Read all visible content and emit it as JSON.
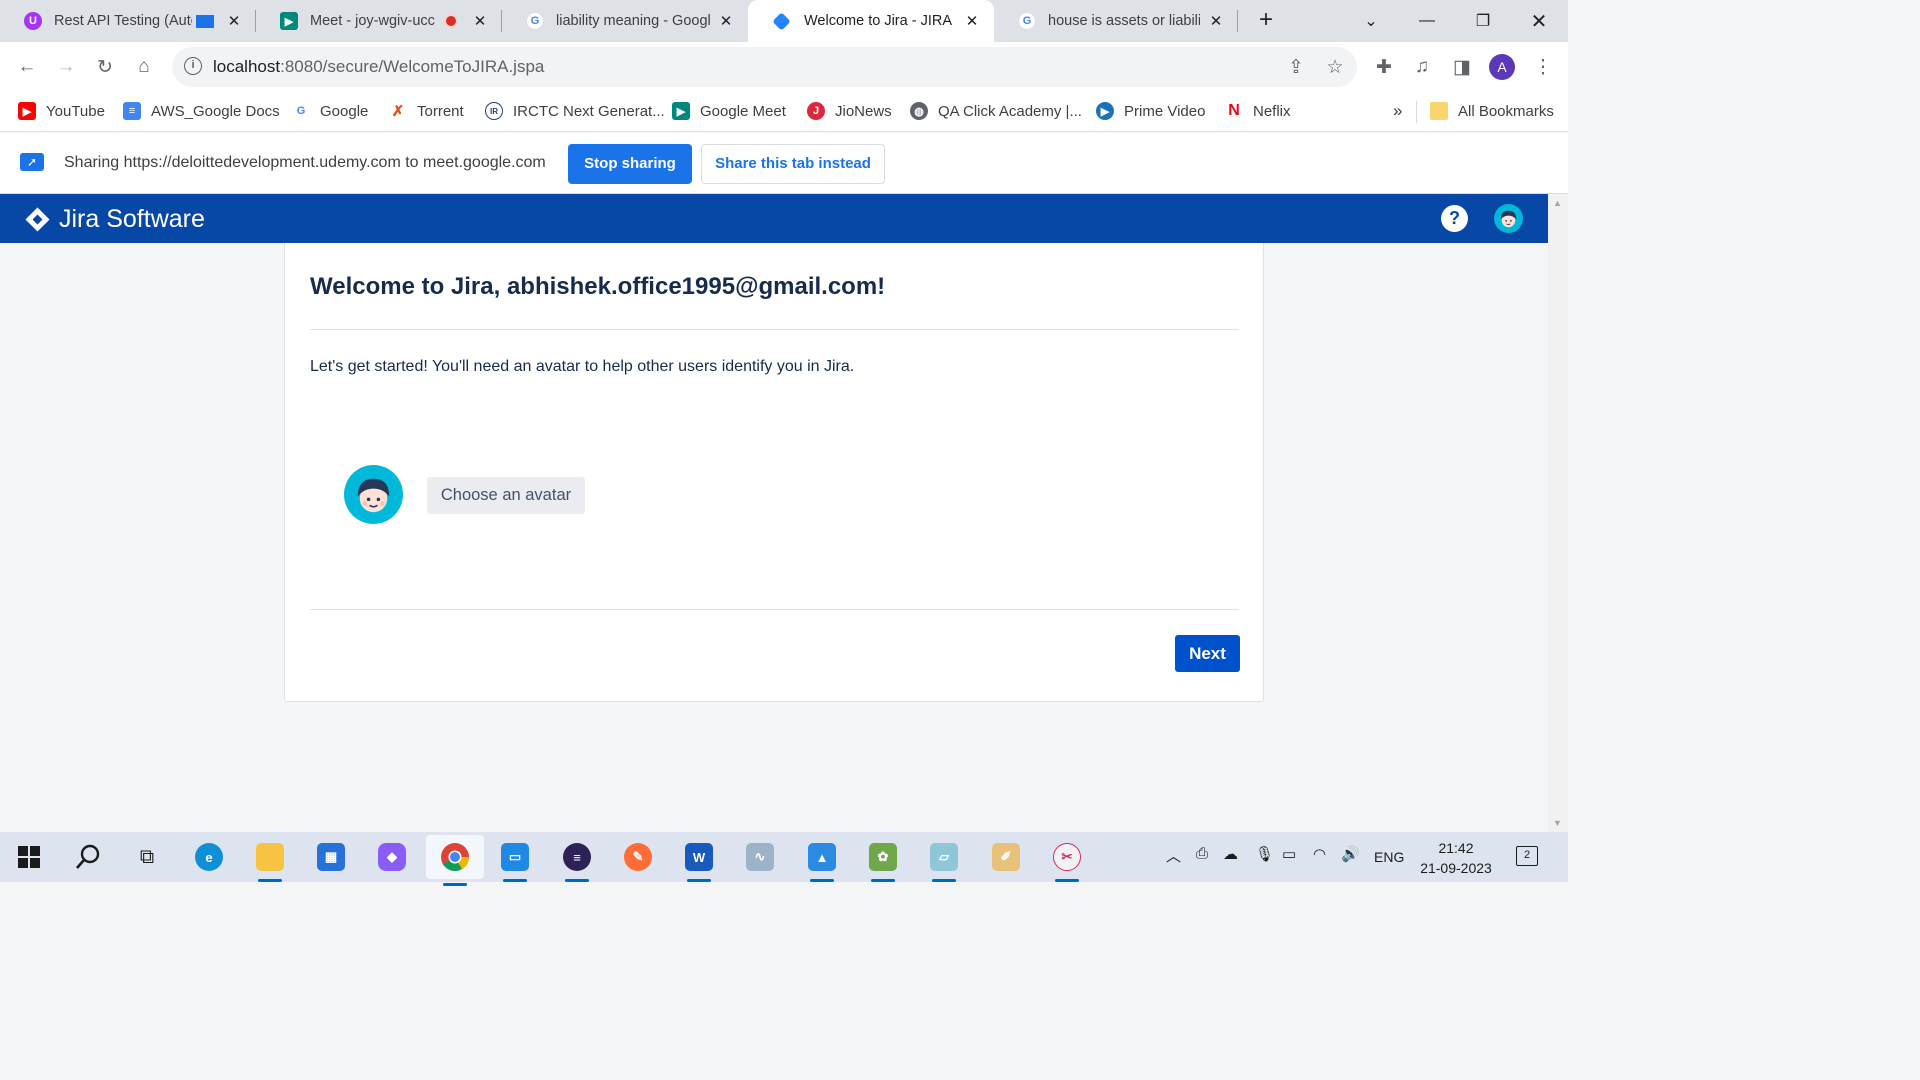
{
  "browser": {
    "tabs": [
      {
        "title": "Rest API Testing (Auto",
        "favicon": "udemy-icon",
        "active": false
      },
      {
        "title": "Meet - joy-wgiv-ucc",
        "favicon": "google-meet-icon",
        "active": false
      },
      {
        "title": "liability meaning - Google",
        "favicon": "google-icon",
        "active": false
      },
      {
        "title": "Welcome to Jira - JIRA",
        "favicon": "jira-icon",
        "active": true
      },
      {
        "title": "house is assets or liabilities",
        "favicon": "google-icon",
        "active": false
      }
    ],
    "url_host": "localhost",
    "url_path": ":8080/secure/WelcomeToJIRA.jspa",
    "profile_initial": "A",
    "bookmarks": [
      {
        "label": "YouTube",
        "icon": "youtube-icon"
      },
      {
        "label": "AWS_Google Docs",
        "icon": "docs-icon"
      },
      {
        "label": "Google",
        "icon": "google-icon"
      },
      {
        "label": "Torrent",
        "icon": "torrent-icon"
      },
      {
        "label": "IRCTC Next Generat...",
        "icon": "irctc-icon"
      },
      {
        "label": "Google Meet",
        "icon": "google-meet-icon"
      },
      {
        "label": "JioNews",
        "icon": "jionews-icon"
      },
      {
        "label": "QA Click Academy |...",
        "icon": "globe-icon"
      },
      {
        "label": "Prime Video",
        "icon": "prime-video-icon"
      },
      {
        "label": "Neflix",
        "icon": "netflix-icon"
      }
    ],
    "bookmarks_overflow": "»",
    "all_bookmarks": "All Bookmarks"
  },
  "sharing": {
    "text": "Sharing https://deloittedevelopment.udemy.com to meet.google.com",
    "stop_label": "Stop sharing",
    "share_tab_label": "Share this tab instead"
  },
  "jira": {
    "product": "Jira Software",
    "welcome_title": "Welcome to Jira, abhishek.office1995@gmail.com!",
    "intro": "Let's get started! You'll need an avatar to help other users identify you in Jira.",
    "choose_avatar": "Choose an avatar",
    "next": "Next",
    "help_glyph": "?"
  },
  "taskbar": {
    "language": "ENG",
    "time": "21:42",
    "date": "21-09-2023",
    "notification_count": "2"
  },
  "colors": {
    "jira_blue": "#0747a6",
    "jira_button": "#0052cc",
    "chrome_blue": "#1a73e8",
    "avatar_cyan": "#00b8d9"
  }
}
